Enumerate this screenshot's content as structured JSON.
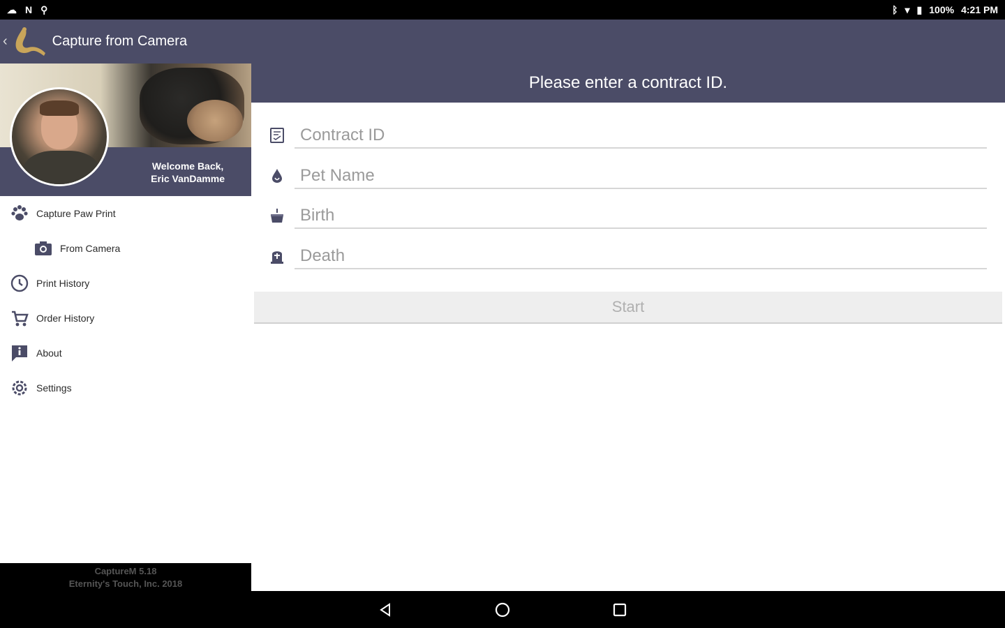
{
  "status": {
    "battery": "100%",
    "time": "4:21 PM"
  },
  "appbar": {
    "title": "Capture from Camera"
  },
  "drawer": {
    "welcome_line1": "Welcome Back,",
    "welcome_line2": "Eric VanDamme",
    "items": [
      {
        "label": "Capture Paw Print",
        "icon": "paw-icon"
      },
      {
        "label": "From Camera",
        "icon": "camera-icon"
      },
      {
        "label": "Print History",
        "icon": "history-icon"
      },
      {
        "label": "Order History",
        "icon": "cart-icon"
      },
      {
        "label": "About",
        "icon": "info-icon"
      },
      {
        "label": "Settings",
        "icon": "gear-icon"
      }
    ],
    "footer_line1": "CaptureM 5.18",
    "footer_line2": "Eternity's Touch, Inc. 2018"
  },
  "main": {
    "banner": "Please enter a contract ID.",
    "fields": {
      "contract": {
        "placeholder": "Contract ID"
      },
      "pet": {
        "placeholder": "Pet Name"
      },
      "birth": {
        "placeholder": "Birth"
      },
      "death": {
        "placeholder": "Death"
      }
    },
    "start_label": "Start"
  },
  "colors": {
    "primary": "#4b4c67",
    "button_bg": "#eeeeee"
  }
}
